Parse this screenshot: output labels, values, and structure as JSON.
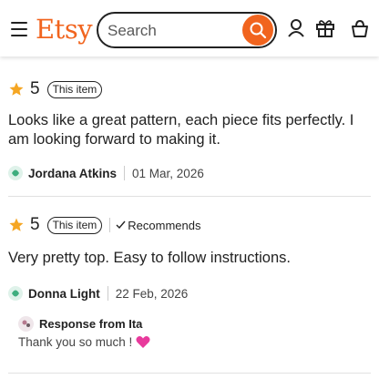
{
  "header": {
    "logo": "Etsy",
    "search_placeholder": "Search",
    "brand_color": "#F1641E"
  },
  "reviews": [
    {
      "rating": "5",
      "badge": "This item",
      "text": "Looks like a great pattern, each piece fits perfectly. I am looking forward to making it.",
      "reviewer": "Jordana Atkins",
      "date": "01 Mar, 2026"
    },
    {
      "rating": "5",
      "badge": "This item",
      "recommends": "Recommends",
      "text": "Very pretty top. Easy to follow instructions.",
      "reviewer": "Donna Light",
      "date": "22 Feb, 2026",
      "response": {
        "title": "Response from Ita",
        "text": "Thank you so much !"
      }
    }
  ],
  "icons": {
    "menu": "hamburger-icon",
    "search": "search-icon",
    "account": "account-icon",
    "gift": "gift-icon",
    "cart": "cart-icon",
    "star": "star-icon",
    "check": "checkmark-icon",
    "avatar": "avatar-icon",
    "heart": "heart-emoji"
  }
}
